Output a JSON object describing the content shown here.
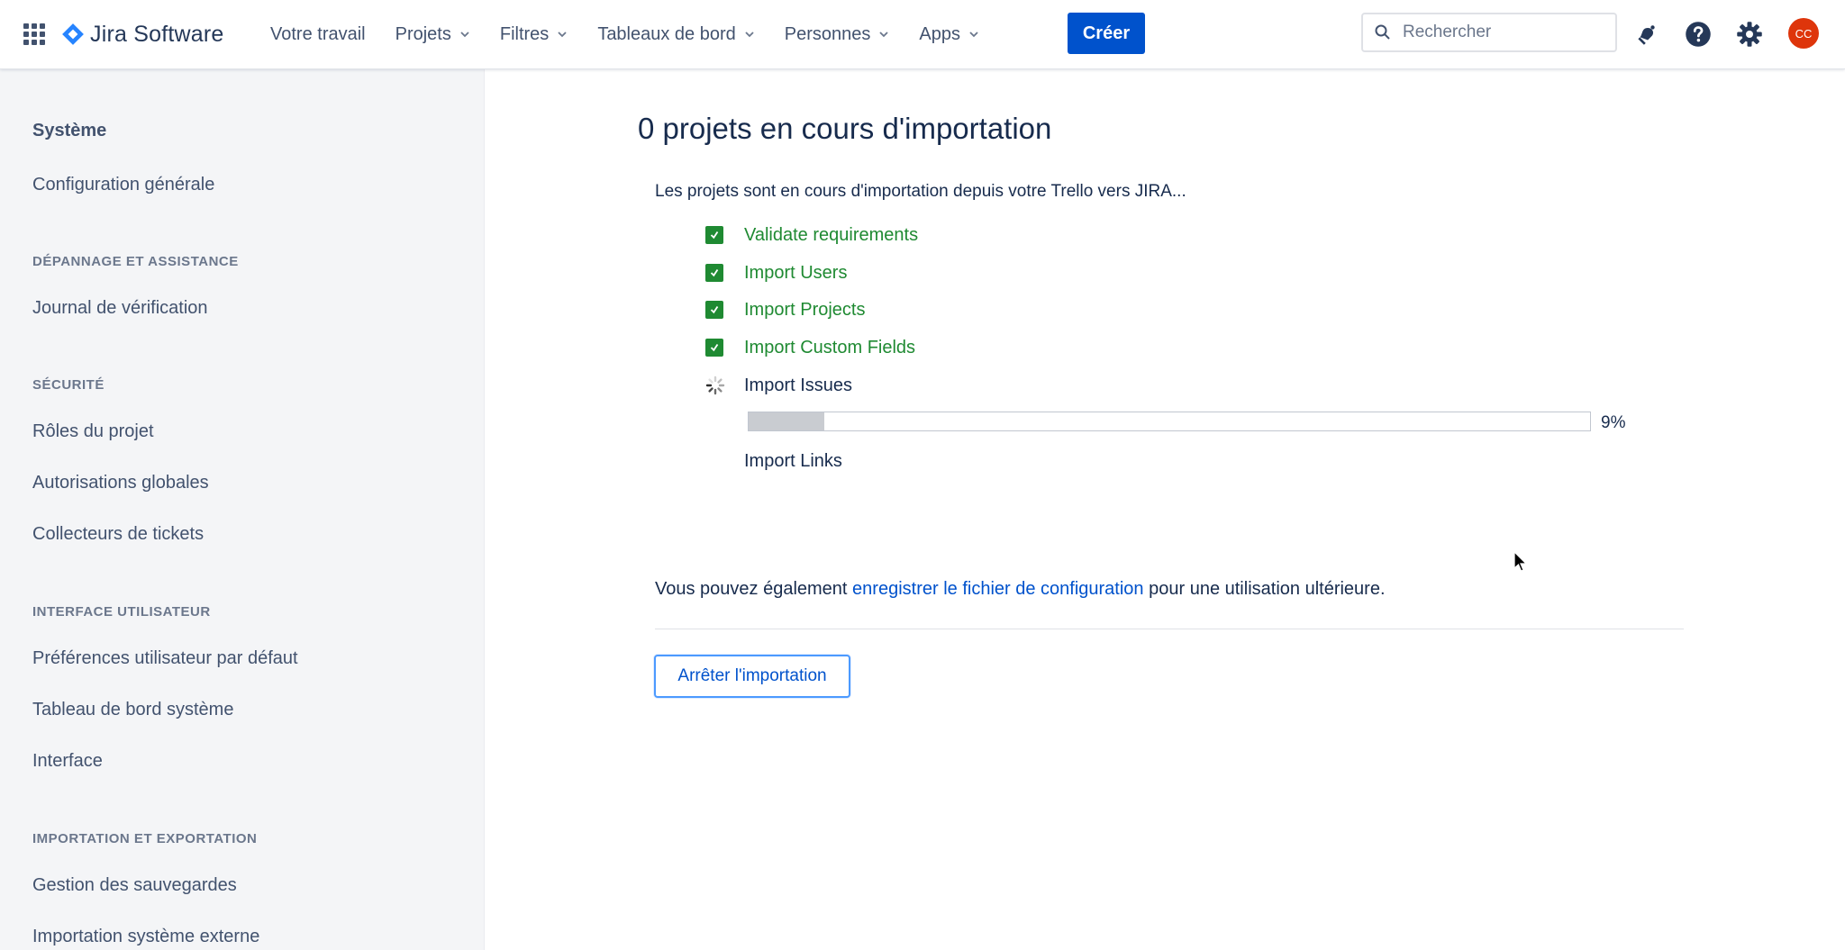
{
  "header": {
    "product_name": "Jira Software",
    "nav": [
      "Votre travail",
      "Projets",
      "Filtres",
      "Tableaux de bord",
      "Personnes",
      "Apps"
    ],
    "create_label": "Créer",
    "search_placeholder": "Rechercher",
    "avatar_initials": "CC"
  },
  "sidebar": {
    "heading": "Système",
    "items": [
      "Configuration générale",
      "Journal de vérification",
      "Rôles du projet",
      "Autorisations globales",
      "Collecteurs de tickets",
      "Préférences utilisateur par défaut",
      "Tableau de bord système",
      "Interface",
      "Gestion des sauvegardes",
      "Importation système externe"
    ],
    "sections": [
      "DÉPANNAGE ET ASSISTANCE",
      "SÉCURITÉ",
      "INTERFACE UTILISATEUR",
      "IMPORTATION ET EXPORTATION"
    ]
  },
  "main": {
    "title": "0 projets en cours d'importation",
    "intro": "Les projets sont en cours d'importation depuis votre Trello vers JIRA...",
    "steps": [
      {
        "label": "Validate requirements",
        "status": "done"
      },
      {
        "label": "Import Users",
        "status": "done"
      },
      {
        "label": "Import Projects",
        "status": "done"
      },
      {
        "label": "Import Custom Fields",
        "status": "done"
      },
      {
        "label": "Import Issues",
        "status": "in-progress"
      },
      {
        "label": "Import Links",
        "status": "pending"
      }
    ],
    "progress_value": 9,
    "progress_text": "9%",
    "note_before": "Vous pouvez également ",
    "note_link": "enregistrer le fichier de configuration",
    "note_after": " pour une utilisation ultérieure.",
    "stop_button": "Arrêter l'importation"
  },
  "colors": {
    "brand": "#0052cc",
    "success": "#1f8a32",
    "avatar": "#de350b"
  }
}
